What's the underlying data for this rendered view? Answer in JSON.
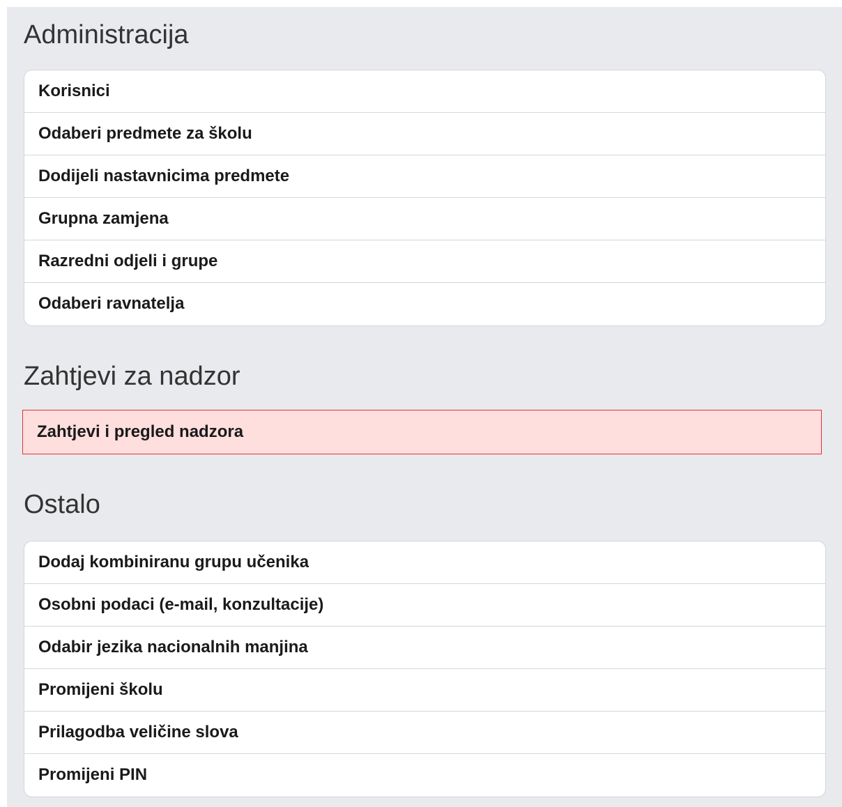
{
  "sections": [
    {
      "title": "Administracija",
      "items": [
        {
          "label": "Korisnici"
        },
        {
          "label": "Odaberi predmete za školu"
        },
        {
          "label": "Dodijeli nastavnicima predmete"
        },
        {
          "label": "Grupna zamjena"
        },
        {
          "label": "Razredni odjeli i grupe"
        },
        {
          "label": "Odaberi ravnatelja"
        }
      ]
    },
    {
      "title": "Zahtjevi za nadzor",
      "items": [
        {
          "label": "Zahtjevi i pregled nadzora",
          "highlighted": true
        }
      ]
    },
    {
      "title": "Ostalo",
      "items": [
        {
          "label": "Dodaj kombiniranu grupu učenika"
        },
        {
          "label": "Osobni podaci (e-mail, konzultacije)"
        },
        {
          "label": "Odabir jezika nacionalnih manjina"
        },
        {
          "label": "Promijeni školu"
        },
        {
          "label": "Prilagodba veličine slova"
        },
        {
          "label": "Promijeni PIN"
        }
      ]
    }
  ],
  "colors": {
    "panel_background": "#e8eaed",
    "highlight_background": "#ffdede",
    "highlight_border": "#e0323a"
  }
}
